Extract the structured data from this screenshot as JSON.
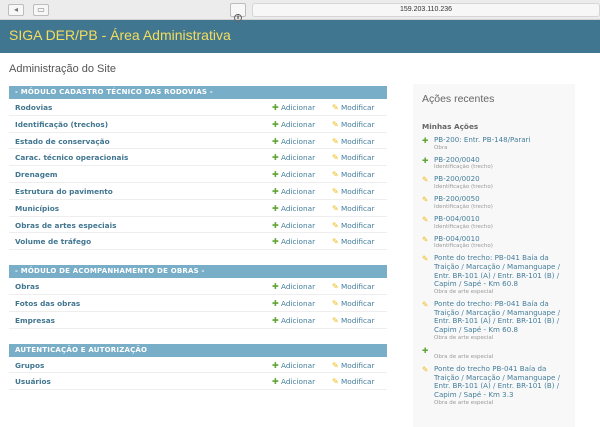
{
  "browser": {
    "url": "159.203.110.236"
  },
  "header": {
    "title": "SIGA DER/PB - Área Administrativa"
  },
  "page_title": "Administração do Site",
  "labels": {
    "add": "Adicionar",
    "change": "Modificar"
  },
  "modules": [
    {
      "caption": "- MÓDULO CADASTRO TÉCNICO DAS RODOVIAS -",
      "rows": [
        "Rodovias",
        "Identificação (trechos)",
        "Estado de conservação",
        "Carac. técnico operacionais",
        "Drenagem",
        "Estrutura do pavimento",
        "Municípios",
        "Obras de artes especiais",
        "Volume de tráfego"
      ]
    },
    {
      "caption": "- MÓDULO DE ACOMPANHAMENTO DE OBRAS -",
      "rows": [
        "Obras",
        "Fotos das obras",
        "Empresas"
      ]
    },
    {
      "caption": "AUTENTICAÇÃO E AUTORIZAÇÃO",
      "rows": [
        "Grupos",
        "Usuários"
      ]
    }
  ],
  "recent": {
    "title": "Ações recentes",
    "subtitle": "Minhas Ações",
    "items": [
      {
        "type": "add",
        "text": "PB-200: Entr. PB-148/Parari",
        "sub": "Obra"
      },
      {
        "type": "add",
        "text": "PB-200/0040",
        "sub": "Identificação (trecho)"
      },
      {
        "type": "change",
        "text": "PB-200/0020",
        "sub": "Identificação (trecho)"
      },
      {
        "type": "change",
        "text": "PB-200/0050",
        "sub": "Identificação (trecho)"
      },
      {
        "type": "change",
        "text": "PB-004/0010",
        "sub": "Identificação (trecho)"
      },
      {
        "type": "change",
        "text": "PB-004/0010",
        "sub": "Identificação (trecho)"
      },
      {
        "type": "change",
        "text": "Ponte do trecho: PB-041 Baía da Traição / Marcação / Mamanguape / Entr. BR-101 (A) / Entr. BR-101 (B) / Capim / Sapé - Km 60.8",
        "sub": "Obra de arte especial"
      },
      {
        "type": "change",
        "text": "Ponte do trecho: PB-041 Baía da Traição / Marcação / Mamanguape / Entr. BR-101 (A) / Entr. BR-101 (B) / Capim / Sapé - Km 60.8",
        "sub": "Obra de arte especial"
      },
      {
        "type": "add",
        "text": "",
        "sub": "Obra de arte especial"
      },
      {
        "type": "change",
        "text": "Ponte do trecho PB-041 Baía da Traição / Marcação / Mamanguape / Entr. BR-101 (A) / Entr. BR-101 (B) / Capim / Sapé - Km 3.3",
        "sub": "Obra de arte especial"
      }
    ]
  }
}
